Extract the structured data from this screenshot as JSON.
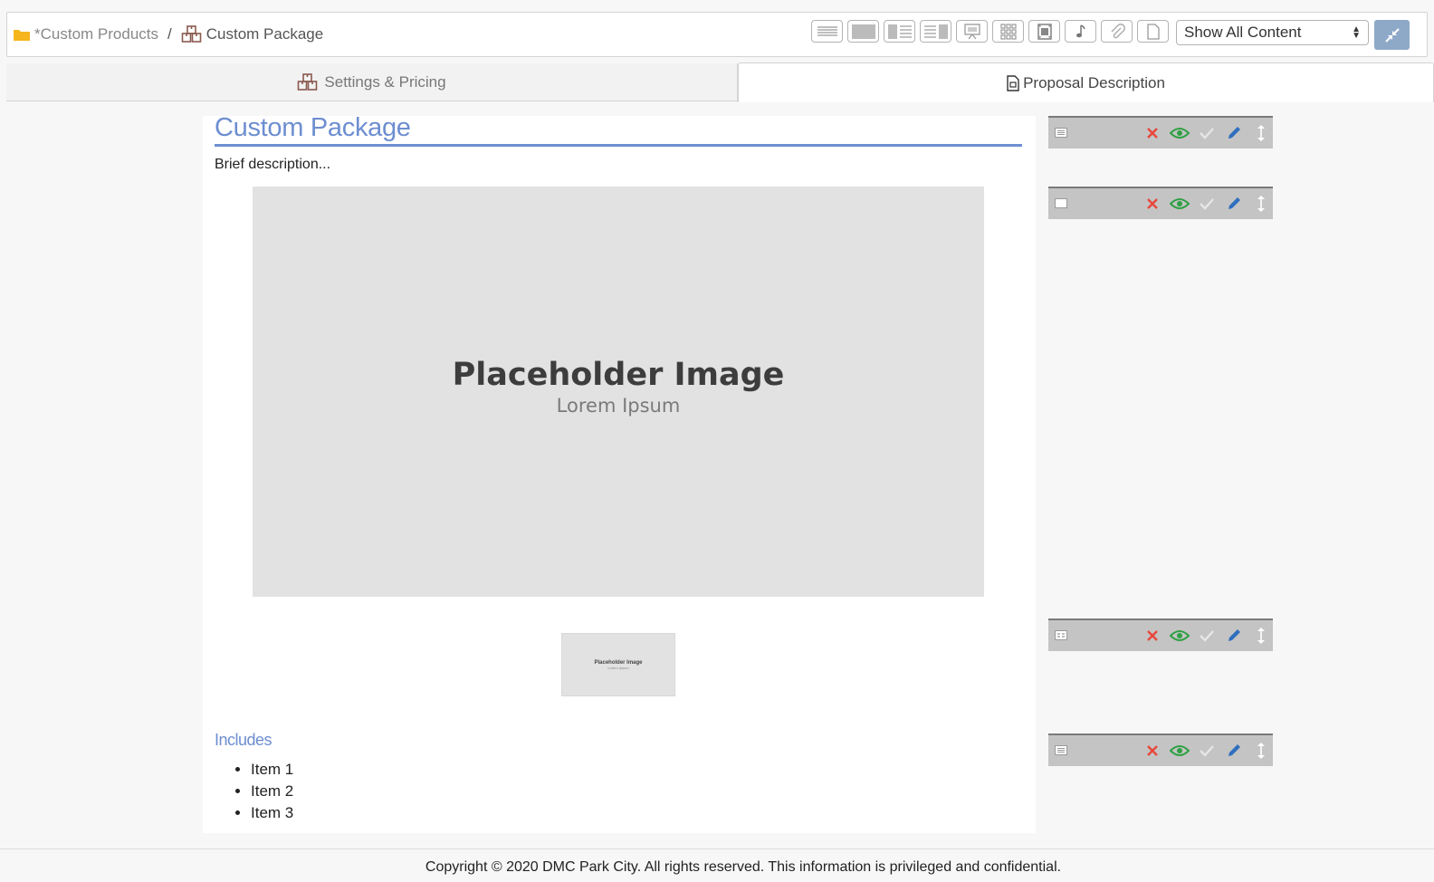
{
  "breadcrumb": {
    "parent": "*Custom Products",
    "separator": "/",
    "current": "Custom Package"
  },
  "toolbar": {
    "buttons": [
      "text-block-icon",
      "image-block-icon",
      "image-left-text-icon",
      "text-image-right-icon",
      "presentation-icon",
      "gallery-icon",
      "video-icon",
      "audio-icon",
      "attachment-icon",
      "page-icon"
    ]
  },
  "filter": {
    "selected": "Show All Content"
  },
  "tabs": {
    "settings": "Settings & Pricing",
    "proposal": "Proposal Description"
  },
  "content": {
    "title": "Custom Package",
    "brief": "Brief description...",
    "image": {
      "title": "Placeholder Image",
      "subtitle": "Lorem Ipsum"
    },
    "thumb": {
      "title": "Placeholder Image",
      "subtitle": "Lorem Ipsum"
    },
    "includes_heading": "Includes",
    "items": [
      "Item 1",
      "Item 2",
      "Item 3"
    ]
  },
  "blocks": [
    {
      "type": "text-block-icon"
    },
    {
      "type": "image-block-icon"
    },
    {
      "type": "gallery-block-icon"
    },
    {
      "type": "text-block-icon"
    }
  ],
  "colors": {
    "accent": "#6d8ed0",
    "delete": "#e8473b",
    "visible": "#2ea043",
    "edit": "#2f6fbe",
    "folder": "#f5b51d",
    "package": "#8a5a4f"
  },
  "footer": {
    "text": "Copyright © 2020 DMC Park City. All rights reserved. This information is privileged and confidential."
  }
}
